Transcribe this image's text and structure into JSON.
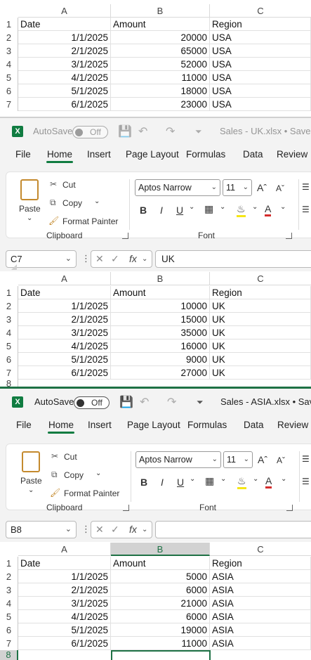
{
  "windows": [
    {
      "title": "",
      "autosave_label": "",
      "autosave_state": "",
      "name_box": "",
      "formula": "",
      "columns": [
        "A",
        "B",
        "C"
      ],
      "rows": [
        [
          "Date",
          "Amount",
          "Region"
        ],
        [
          "1/1/2025",
          "20000",
          "USA"
        ],
        [
          "2/1/2025",
          "65000",
          "USA"
        ],
        [
          "3/1/2025",
          "52000",
          "USA"
        ],
        [
          "4/1/2025",
          "11000",
          "USA"
        ],
        [
          "5/1/2025",
          "18000",
          "USA"
        ],
        [
          "6/1/2025",
          "23000",
          "USA"
        ]
      ],
      "row_numbers": [
        "1",
        "2",
        "3",
        "4",
        "5",
        "6",
        "7"
      ]
    },
    {
      "title": "Sales - UK.xlsx • Saved to",
      "autosave_label": "AutoSave",
      "autosave_state": "Off",
      "name_box": "C7",
      "formula": "UK",
      "columns": [
        "A",
        "B",
        "C"
      ],
      "rows": [
        [
          "Date",
          "Amount",
          "Region"
        ],
        [
          "1/1/2025",
          "10000",
          "UK"
        ],
        [
          "2/1/2025",
          "15000",
          "UK"
        ],
        [
          "3/1/2025",
          "35000",
          "UK"
        ],
        [
          "4/1/2025",
          "16000",
          "UK"
        ],
        [
          "5/1/2025",
          "9000",
          "UK"
        ],
        [
          "6/1/2025",
          "27000",
          "UK"
        ]
      ],
      "row_numbers": [
        "1",
        "2",
        "3",
        "4",
        "5",
        "6",
        "7",
        "8"
      ]
    },
    {
      "title": "Sales - ASIA.xlsx • Saved",
      "autosave_label": "AutoSave",
      "autosave_state": "Off",
      "name_box": "B8",
      "formula": "",
      "columns": [
        "A",
        "B",
        "C"
      ],
      "rows": [
        [
          "Date",
          "Amount",
          "Region"
        ],
        [
          "1/1/2025",
          "5000",
          "ASIA"
        ],
        [
          "2/1/2025",
          "6000",
          "ASIA"
        ],
        [
          "3/1/2025",
          "21000",
          "ASIA"
        ],
        [
          "4/1/2025",
          "6000",
          "ASIA"
        ],
        [
          "5/1/2025",
          "19000",
          "ASIA"
        ],
        [
          "6/1/2025",
          "11000",
          "ASIA"
        ]
      ],
      "row_numbers": [
        "1",
        "2",
        "3",
        "4",
        "5",
        "6",
        "7",
        "8"
      ]
    }
  ],
  "ribbon": {
    "tabs": [
      "File",
      "Home",
      "Insert",
      "Page Layout",
      "Formulas",
      "Data",
      "Review"
    ],
    "active_tab": "Home",
    "clipboard": {
      "paste": "Paste",
      "cut": "Cut",
      "copy": "Copy",
      "format_painter": "Format Painter",
      "group_label": "Clipboard"
    },
    "font": {
      "font_name": "Aptos Narrow",
      "font_size": "11",
      "bold": "B",
      "italic": "I",
      "underline": "U",
      "group_label": "Font"
    }
  },
  "fx_label": "fx",
  "colors": {
    "excel_green": "#107c41",
    "selection_green": "#1e7145",
    "save_icon_purple": "#8b2c8e"
  }
}
